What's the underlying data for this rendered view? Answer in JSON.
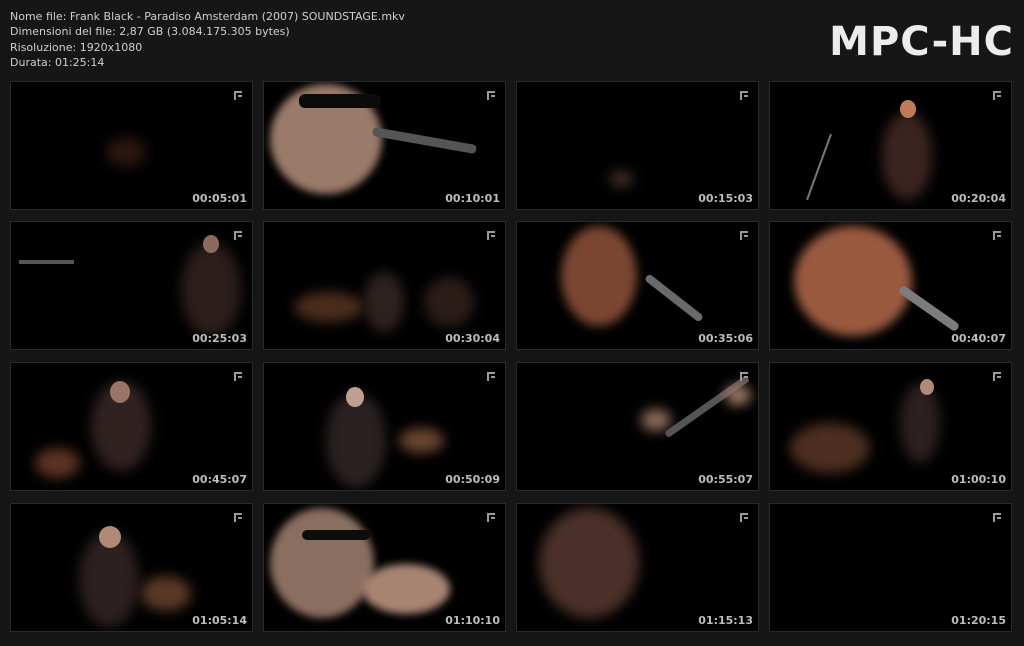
{
  "header": {
    "file_name": "Nome file: Frank Black - Paradiso Amsterdam (2007) SOUNDSTAGE.mkv",
    "file_size": "Dimensioni del file: 2,87 GB (3.084.175.305 bytes)",
    "resolution": "Risoluzione: 1920x1080",
    "duration": "Durata: 01:25:14"
  },
  "logo": "MPC-HC",
  "thumbnails": [
    {
      "timestamp": "00:05:01",
      "scene": "dark-stage"
    },
    {
      "timestamp": "00:10:01",
      "scene": "singer-closeup-sunglasses"
    },
    {
      "timestamp": "00:15:03",
      "scene": "dark-stage-wide"
    },
    {
      "timestamp": "00:20:04",
      "scene": "guitarist-redhair"
    },
    {
      "timestamp": "00:25:03",
      "scene": "band-wide"
    },
    {
      "timestamp": "00:30:04",
      "scene": "stage-drums-wide"
    },
    {
      "timestamp": "00:35:06",
      "scene": "singer-redhair-mic"
    },
    {
      "timestamp": "00:40:07",
      "scene": "singer-redhair-closeup"
    },
    {
      "timestamp": "00:45:07",
      "scene": "singer-bald-drums"
    },
    {
      "timestamp": "00:50:09",
      "scene": "singer-back-drums"
    },
    {
      "timestamp": "00:55:07",
      "scene": "guitar-neck-closeup"
    },
    {
      "timestamp": "01:00:10",
      "scene": "stage-right-performer"
    },
    {
      "timestamp": "01:05:14",
      "scene": "singer-drummer"
    },
    {
      "timestamp": "01:10:10",
      "scene": "bald-singer-mic-closeup"
    },
    {
      "timestamp": "01:15:13",
      "scene": "bald-singer-dark-closeup"
    },
    {
      "timestamp": "01:20:15",
      "scene": "dark-frame"
    }
  ]
}
